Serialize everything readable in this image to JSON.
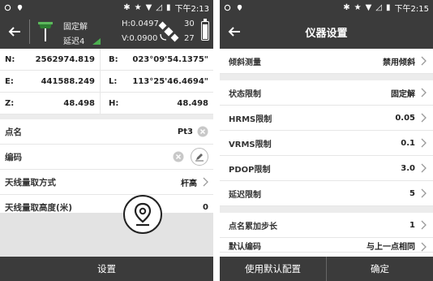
{
  "left": {
    "status": {
      "time": "下午2:13"
    },
    "header": {
      "fix": "固定解",
      "delay": "延迟4",
      "h": "H:0.0497",
      "v": "V:0.0900",
      "sat_top": "30",
      "sat_bottom": "27"
    },
    "coords": [
      {
        "l1": "N:",
        "v1": "2562974.819",
        "l2": "B:",
        "v2": "023°09'54.1375\""
      },
      {
        "l1": "E:",
        "v1": "441588.249",
        "l2": "L:",
        "v2": "113°25'46.4694\""
      },
      {
        "l1": "Z:",
        "v1": "48.498",
        "l2": "H:",
        "v2": "48.498"
      }
    ],
    "fields": {
      "point_name_label": "点名",
      "point_name_value": "Pt3",
      "code_label": "编码",
      "antenna_method_label": "天线量取方式",
      "antenna_method_value": "杆高",
      "antenna_height_label": "天线量取高度(米)",
      "antenna_height_value": "0"
    },
    "bottom": {
      "settings": "设置"
    }
  },
  "right": {
    "status": {
      "time": "下午2:15"
    },
    "title": "仪器设置",
    "rows": [
      {
        "label": "倾斜测量",
        "value": "禁用倾斜"
      },
      {
        "label": "状态限制",
        "value": "固定解"
      },
      {
        "label": "HRMS限制",
        "value": "0.05"
      },
      {
        "label": "VRMS限制",
        "value": "0.1"
      },
      {
        "label": "PDOP限制",
        "value": "3.0"
      },
      {
        "label": "延迟限制",
        "value": "5"
      },
      {
        "label": "点名累加步长",
        "value": "1"
      },
      {
        "label": "默认编码",
        "value": "与上一点相同"
      }
    ],
    "buttons": {
      "default": "使用默认配置",
      "ok": "确定"
    }
  },
  "colors": {
    "bar": "#3b3b3b",
    "accent": "#2e7d32"
  }
}
